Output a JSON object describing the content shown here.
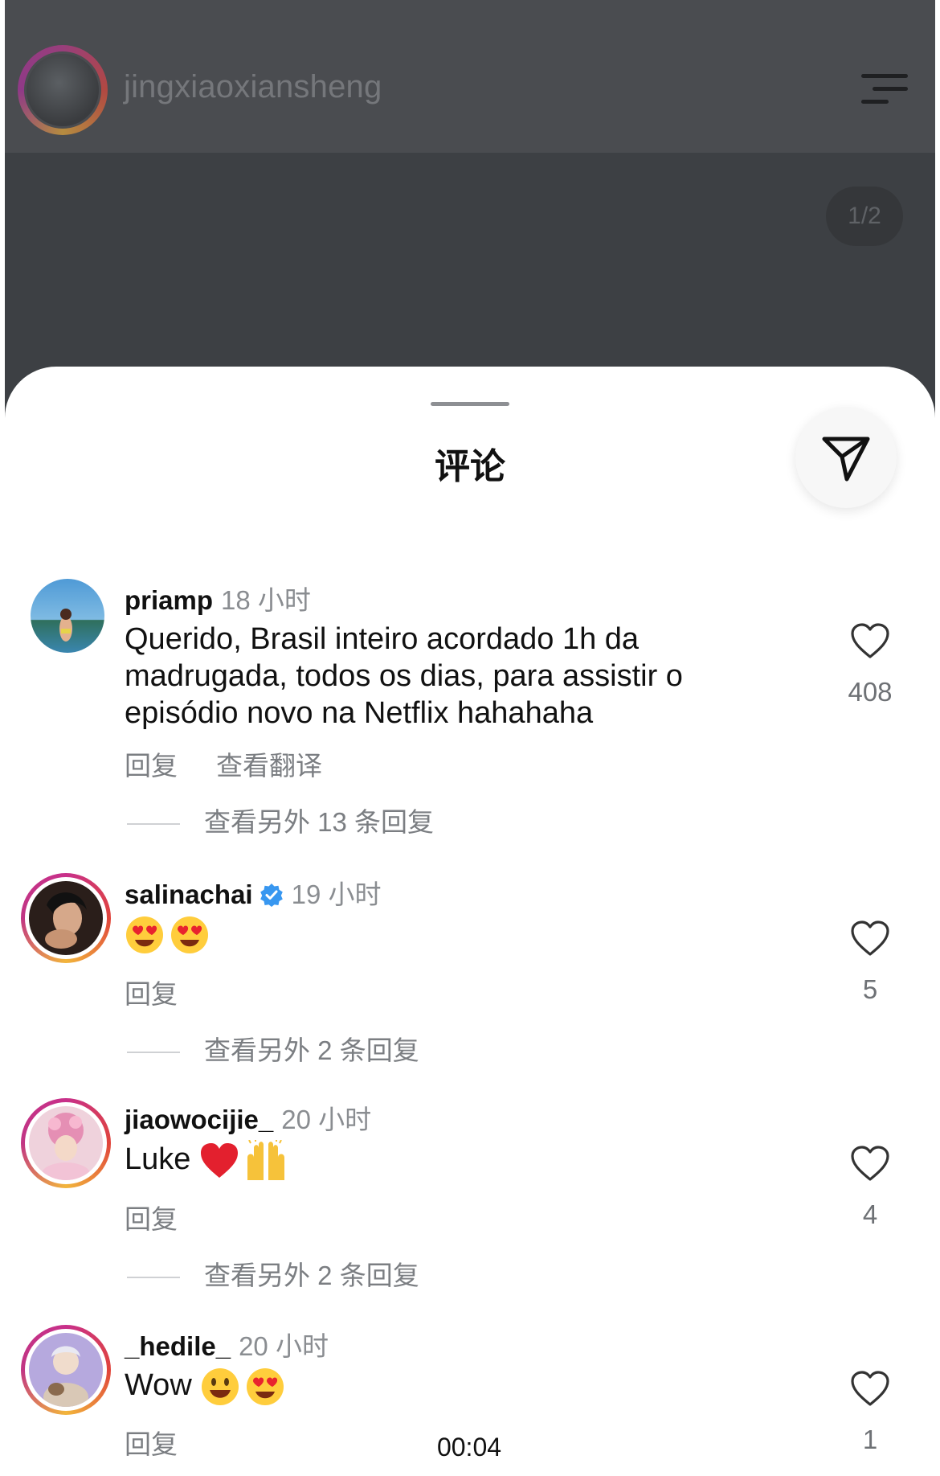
{
  "post": {
    "username": "jingxiaoxiansheng",
    "page_counter": "1/2"
  },
  "sheet": {
    "title": "评论"
  },
  "comments": [
    {
      "username": "priamp",
      "time": "18 小时",
      "text": "Querido, Brasil inteiro acordado 1h da madrugada, todos os dias, para assistir o episódio novo na Netflix hahahaha",
      "reply_label": "回复",
      "translate_label": "查看翻译",
      "more_replies": "查看另外 13 条回复",
      "likes": "408",
      "verified": false
    },
    {
      "username": "salinachai",
      "time": "19 小时",
      "text": "",
      "emojis": [
        "heart-eyes-emoji",
        "heart-eyes-emoji"
      ],
      "reply_label": "回复",
      "more_replies": "查看另外 2 条回复",
      "likes": "5",
      "verified": true
    },
    {
      "username": "jiaowocijie_",
      "time": "20 小时",
      "text": "Luke",
      "emojis": [
        "red-heart-emoji",
        "raising-hands-emoji"
      ],
      "reply_label": "回复",
      "more_replies": "查看另外 2 条回复",
      "likes": "4",
      "verified": false
    },
    {
      "username": "_hedile_",
      "time": "20 小时",
      "text": "Wow",
      "emojis": [
        "smiley-emoji",
        "heart-eyes-emoji"
      ],
      "reply_label": "回复",
      "likes": "1",
      "verified": false
    }
  ],
  "video": {
    "timestamp": "00:04"
  },
  "colors": {
    "overlay_dark": "#3d4044",
    "secondary_text": "#7b7e82",
    "verified_blue": "#3897f0",
    "story_ring": "#c13584"
  }
}
